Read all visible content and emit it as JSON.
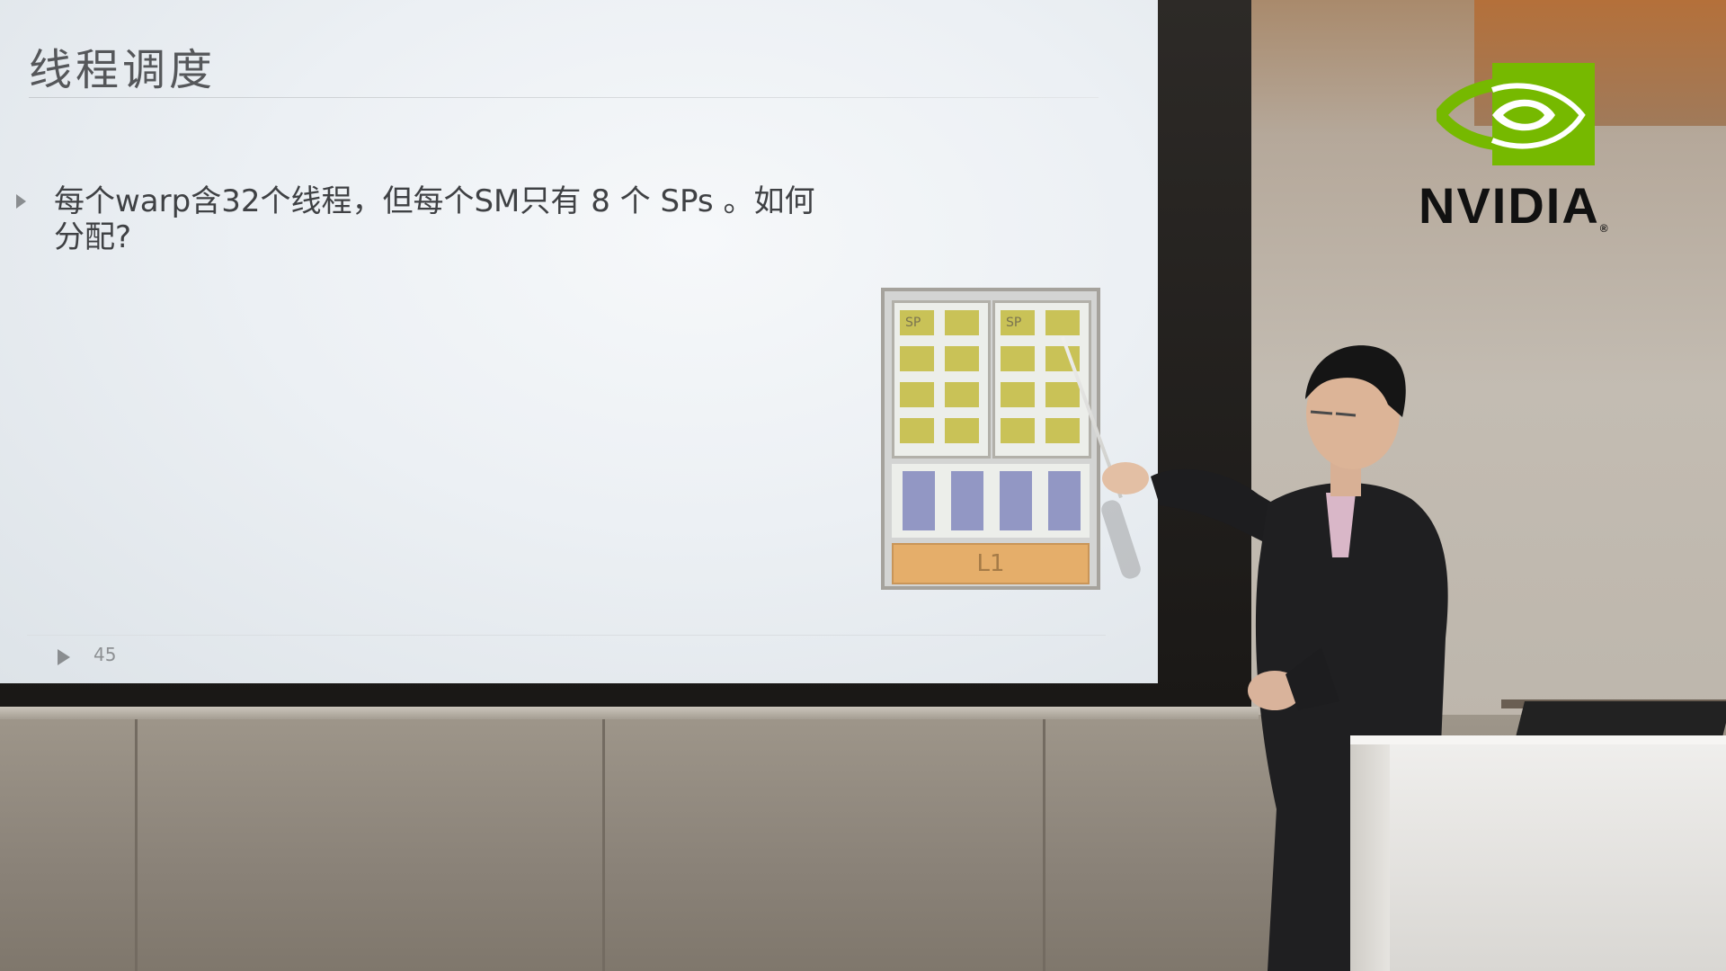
{
  "slide": {
    "title": "线程调度",
    "bullet": "每个warp含32个线程，但每个SM只有 8 个 SPs 。如何分配?",
    "page_number": "45"
  },
  "diagram": {
    "sp_label_1": "SP",
    "sp_label_2": "SP",
    "l1_label": "L1",
    "sp_color": "#c9c257",
    "sfu_color": "#9297c4",
    "l1_color": "#e5ae6a"
  },
  "logo": {
    "wordmark": "NVIDIA",
    "reg_mark": "®",
    "brand_color": "#76b900"
  }
}
